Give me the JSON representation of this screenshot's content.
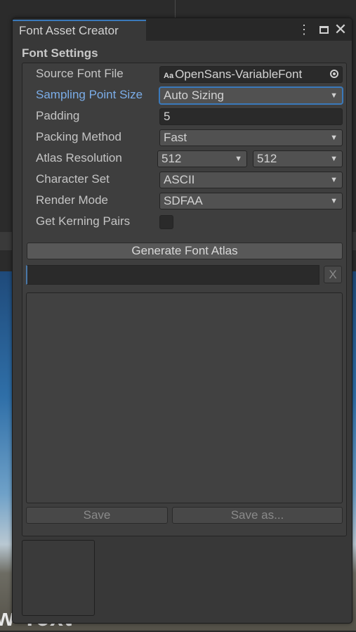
{
  "background": {
    "scene_text": "w Text"
  },
  "window": {
    "tab_title": "Font Asset Creator",
    "icons": {
      "menu": "more-vertical-icon",
      "maximize": "maximize-icon",
      "close": "close-icon"
    }
  },
  "font_settings": {
    "section_title": "Font Settings",
    "source_font_file": {
      "label": "Source Font File",
      "value": "OpenSans-VariableFont",
      "type_icon": "Aa"
    },
    "sampling_point_size": {
      "label": "Sampling Point Size",
      "value": "Auto Sizing"
    },
    "padding": {
      "label": "Padding",
      "value": "5"
    },
    "packing_method": {
      "label": "Packing Method",
      "value": "Fast"
    },
    "atlas_resolution": {
      "label": "Atlas Resolution",
      "width": "512",
      "height": "512"
    },
    "character_set": {
      "label": "Character Set",
      "value": "ASCII"
    },
    "render_mode": {
      "label": "Render Mode",
      "value": "SDFAA"
    },
    "get_kerning_pairs": {
      "label": "Get Kerning Pairs",
      "checked": false
    },
    "generate_button": "Generate Font Atlas",
    "clear_button": "X",
    "save_button": "Save",
    "save_as_button": "Save as..."
  },
  "colors": {
    "accent": "#3a79bb",
    "active_label": "#7bade8",
    "window_bg": "#383838"
  }
}
